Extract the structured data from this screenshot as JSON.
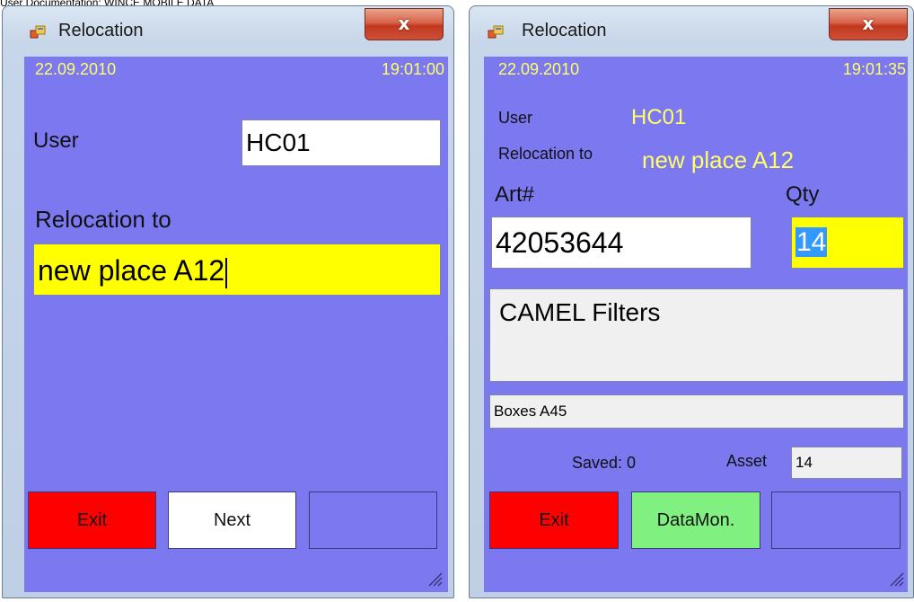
{
  "doc_header": "User Documentation: WINCE MOBILE DATA",
  "left_window": {
    "title": "Relocation",
    "close_label": "x",
    "date": "22.09.2010",
    "time": "19:01:00",
    "user_label": "User",
    "user_value": "HC01",
    "relocation_label": "Relocation to",
    "relocation_value": "new place A12",
    "exit_label": "Exit",
    "next_label": "Next",
    "blank_label": ""
  },
  "right_window": {
    "title": "Relocation",
    "close_label": "x",
    "date": "22.09.2010",
    "time": "19:01:35",
    "user_label": "User",
    "user_value": "HC01",
    "relocation_label": "Relocation to",
    "relocation_value": "new place A12",
    "art_label": "Art#",
    "art_value": "42053644",
    "qty_label": "Qty",
    "qty_value": "14",
    "description": "CAMEL Filters",
    "location": "Boxes A45",
    "saved_label": "Saved: 0",
    "asset_label": "Asset",
    "asset_value": "14",
    "exit_label": "Exit",
    "datamon_label": "DataMon.",
    "blank_label": ""
  },
  "colors": {
    "client_bg": "#7b78f0",
    "date_time": "#ffff66",
    "exit_button": "#ff0000",
    "datamon_button": "#80f080",
    "highlight_field": "#ffff00",
    "selection": "#3399ff"
  }
}
